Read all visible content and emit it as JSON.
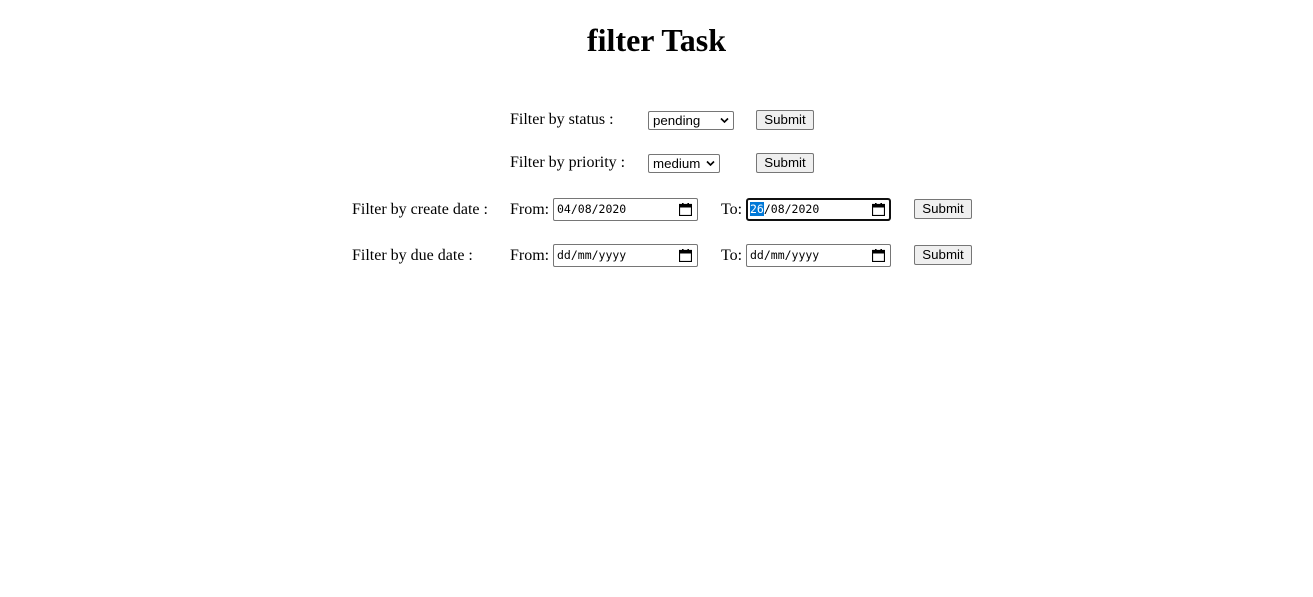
{
  "page": {
    "title": "filter Task"
  },
  "status_filter": {
    "label": "Filter by status :",
    "selected": "pending",
    "submit_label": "Submit"
  },
  "priority_filter": {
    "label": "Filter by priority :",
    "selected": "medium",
    "submit_label": "Submit"
  },
  "create_date_filter": {
    "label": "Filter by create date :",
    "from_label": "From:",
    "from_value": "04/08/2020",
    "to_label": "To:",
    "to_value_day": "26",
    "to_value_rest": "/08/2020",
    "submit_label": "Submit"
  },
  "due_date_filter": {
    "label": "Filter by due date :",
    "from_label": "From:",
    "from_value": "dd/mm/yyyy",
    "to_label": "To:",
    "to_value": "dd/mm/yyyy",
    "submit_label": "Submit"
  },
  "icons": {
    "dropdown": "chevron-down-icon",
    "calendar": "calendar-icon"
  },
  "colors": {
    "selection_highlight": "#0078d7",
    "button_bg": "#efefef",
    "border": "#767676"
  }
}
